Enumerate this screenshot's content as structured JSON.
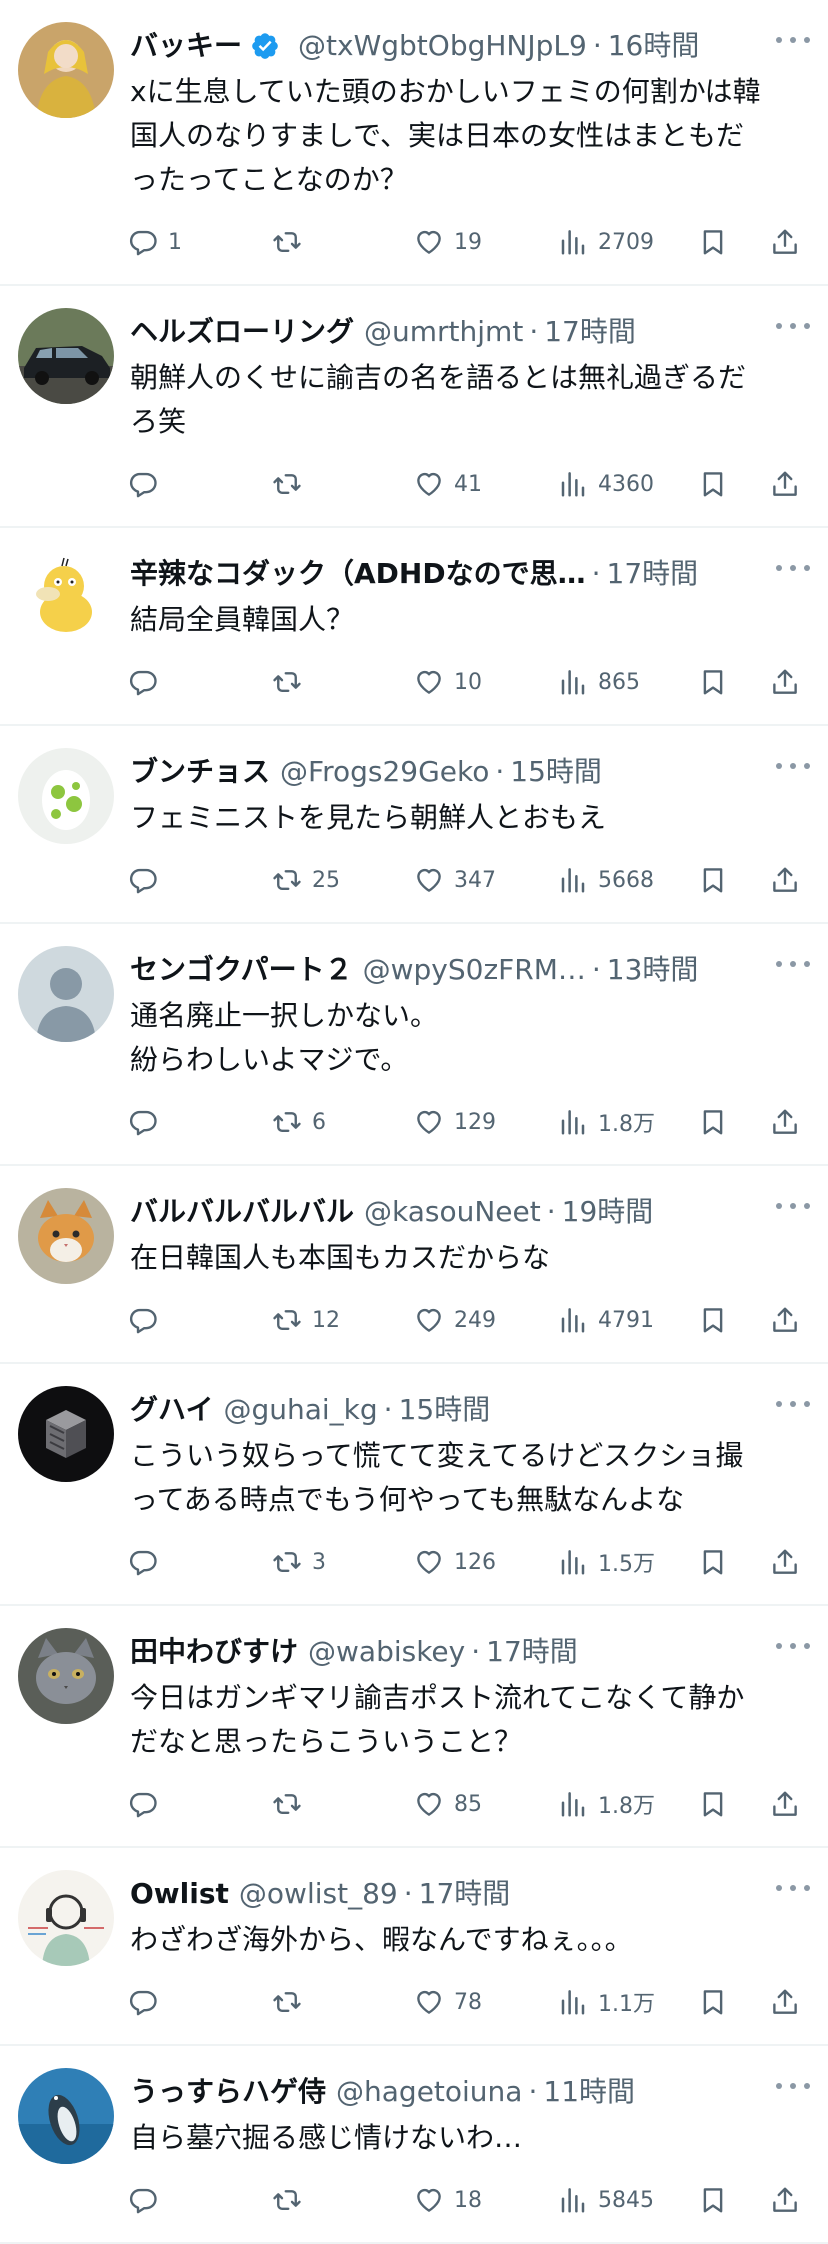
{
  "colors": {
    "text": "#0f1419",
    "secondary": "#536471",
    "divider": "#eff3f4",
    "verified": "#1d9bf0"
  },
  "tweets": [
    {
      "name": "バッキー",
      "verified": true,
      "handle": "@txWgbtObgHNJpL9",
      "time": "16時間",
      "text": "xに生息していた頭のおかしいフェミの何割かは韓\n国人のなりすましで、実は日本の女性はまともだ\nったってことなのか？",
      "replies": "1",
      "retweets": "",
      "likes": "19",
      "views": "2709",
      "avatar": "woman-yellow-dress"
    },
    {
      "name": "ヘルズローリング",
      "verified": false,
      "handle": "@umrthjmt",
      "time": "17時間",
      "text": "朝鮮人のくせに諭吉の名を語るとは無礼過ぎるだ\nろ笑",
      "replies": "",
      "retweets": "",
      "likes": "41",
      "views": "4360",
      "avatar": "black-car"
    },
    {
      "name": "辛辣なコダック（ADHDなので思…",
      "verified": false,
      "handle": "",
      "time": "17時間",
      "text": "結局全員韓国人？",
      "replies": "",
      "retweets": "",
      "likes": "10",
      "views": "865",
      "avatar": "yellow-duck"
    },
    {
      "name": "ブンチョス",
      "verified": false,
      "handle": "@Frogs29Geko",
      "time": "15時間",
      "text": "フェミニストを見たら朝鮮人とおもえ",
      "replies": "",
      "retweets": "25",
      "likes": "347",
      "views": "5668",
      "avatar": "green-spotted-egg"
    },
    {
      "name": "センゴクパート２",
      "verified": false,
      "handle": "@wpyS0zFRM…",
      "time": "13時間",
      "text": "通名廃止一択しかない。\n紛らわしいよマジで。",
      "replies": "",
      "retweets": "6",
      "likes": "129",
      "views": "1.8万",
      "avatar": "default-person"
    },
    {
      "name": "バルバルバルバル",
      "verified": false,
      "handle": "@kasouNeet",
      "time": "19時間",
      "text": "在日韓国人も本国もカスだからな",
      "replies": "",
      "retweets": "12",
      "likes": "249",
      "views": "4791",
      "avatar": "orange-cat"
    },
    {
      "name": "グハイ",
      "verified": false,
      "handle": "@guhai_kg",
      "time": "15時間",
      "text": "こういう奴らって慌てて変えてるけどスクショ撮\nってある時点でもう何やっても無駄なんよな",
      "replies": "",
      "retweets": "3",
      "likes": "126",
      "views": "1.5万",
      "avatar": "dark-cube"
    },
    {
      "name": "田中わびすけ",
      "verified": false,
      "handle": "@wabiskey",
      "time": "17時間",
      "text": "今日はガンギマリ諭吉ポスト流れてこなくて静か\nだなと思ったらこういうこと？",
      "replies": "",
      "retweets": "",
      "likes": "85",
      "views": "1.8万",
      "avatar": "gray-cat"
    },
    {
      "name": "Owlist",
      "verified": false,
      "handle": "@owlist_89",
      "time": "17時間",
      "text": "わざわざ海外から、暇なんですねぇ。。。",
      "replies": "",
      "retweets": "",
      "likes": "78",
      "views": "1.1万",
      "avatar": "headphones-figure"
    },
    {
      "name": "うっすらハゲ侍",
      "verified": false,
      "handle": "@hagetoiuna",
      "time": "11時間",
      "text": "自ら墓穴掘る感じ情けないわ…",
      "replies": "",
      "retweets": "",
      "likes": "18",
      "views": "5845",
      "avatar": "penguin-water"
    }
  ]
}
